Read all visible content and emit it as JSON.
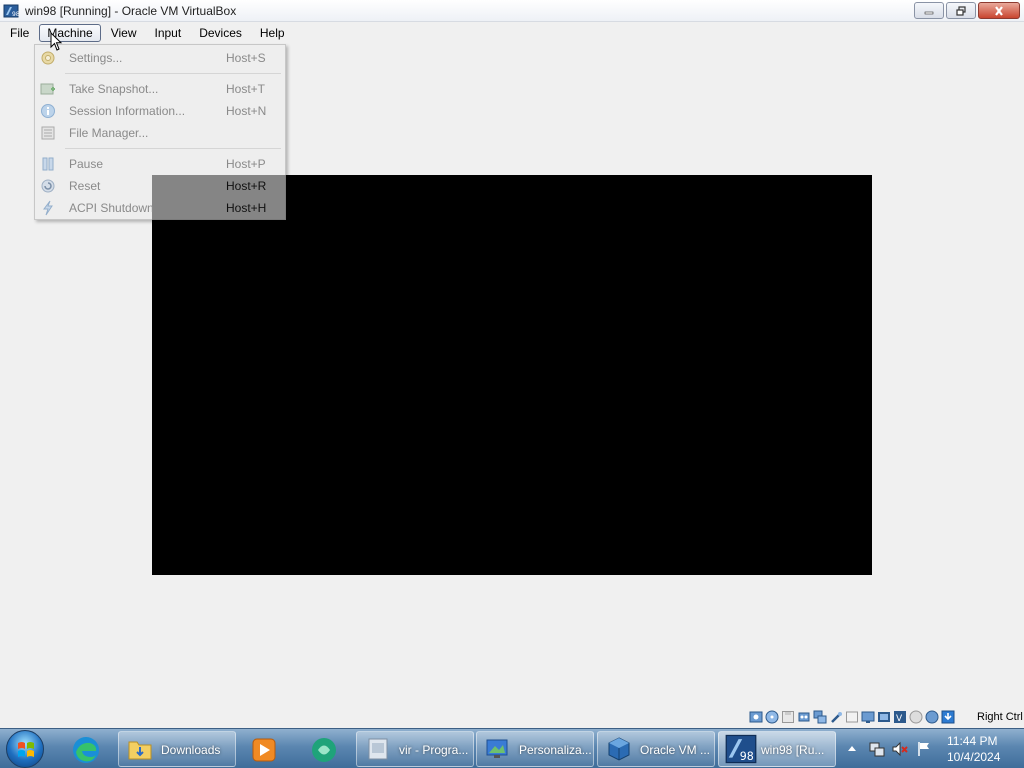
{
  "window": {
    "title": "win98 [Running] - Oracle VM VirtualBox",
    "icon": "virtualbox-icon"
  },
  "menubar": {
    "items": [
      {
        "label": "File"
      },
      {
        "label": "Machine"
      },
      {
        "label": "View"
      },
      {
        "label": "Input"
      },
      {
        "label": "Devices"
      },
      {
        "label": "Help"
      }
    ],
    "open_menu": "Machine"
  },
  "machine_menu": {
    "items": [
      {
        "label": "Settings...",
        "shortcut": "Host+S",
        "icon": "settings-gear-icon"
      },
      {
        "label": "Take Snapshot...",
        "shortcut": "Host+T",
        "icon": "snapshot-icon"
      },
      {
        "label": "Session Information...",
        "shortcut": "Host+N",
        "icon": "info-icon"
      },
      {
        "label": "File Manager...",
        "shortcut": "",
        "icon": "file-manager-icon"
      },
      {
        "label": "Pause",
        "shortcut": "Host+P",
        "icon": "pause-icon"
      },
      {
        "label": "Reset",
        "shortcut": "Host+R",
        "icon": "reset-icon"
      },
      {
        "label": "ACPI Shutdown",
        "shortcut": "Host+H",
        "icon": "acpi-shutdown-icon"
      }
    ]
  },
  "statusbar": {
    "host_key": "Right Ctrl",
    "icons": [
      "hard-disk-icon",
      "optical-drive-icon",
      "floppy-icon",
      "audio-icon",
      "network-icon",
      "usb-icon",
      "shared-folders-icon",
      "display-icon",
      "recording-icon",
      "virtualization-icon",
      "cpu-icon",
      "mouse-integration-icon",
      "keyboard-capture-icon"
    ]
  },
  "taskbar": {
    "pinned": [
      {
        "icon": "edge-icon"
      },
      {
        "label": "Downloads",
        "icon": "folder-icon"
      },
      {
        "icon": "media-player-icon"
      },
      {
        "icon": "chat-app-icon"
      }
    ],
    "tasks": [
      {
        "label": "vir - Progra...",
        "icon": "installer-icon"
      },
      {
        "label": "Personaliza...",
        "icon": "personalization-icon"
      },
      {
        "label": "Oracle VM ...",
        "icon": "virtualbox-icon"
      },
      {
        "label": "win98 [Ru...",
        "icon": "win98-vm-icon"
      }
    ],
    "clock": {
      "time": "11:44 PM",
      "date": "10/4/2024"
    }
  }
}
